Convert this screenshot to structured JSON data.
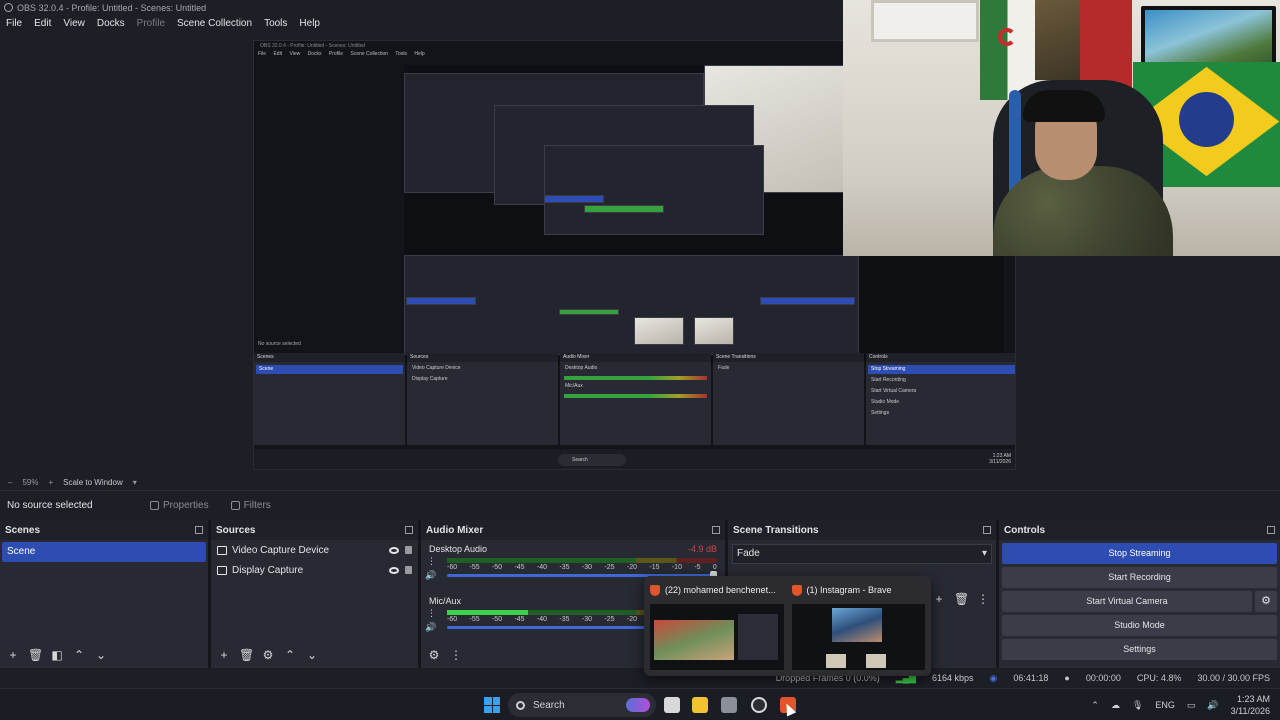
{
  "window": {
    "title": "OBS 32.0.4 - Profile: Untitled - Scenes: Untitled"
  },
  "menu": [
    "File",
    "Edit",
    "View",
    "Docks",
    "Profile",
    "Scene Collection",
    "Tools",
    "Help"
  ],
  "nested_preview": {
    "title": "OBS 32.0.4 - Profile: Untitled - Scenes: Untitled",
    "menu": [
      "File",
      "Edit",
      "View",
      "Docks",
      "Profile",
      "Scene Collection",
      "Tools",
      "Help"
    ],
    "info": "No source selected",
    "scale": "59%",
    "scale_mode": "Scale to Window",
    "docks": [
      "Scenes",
      "Sources",
      "Audio Mixer",
      "Scene Transitions",
      "Controls"
    ],
    "scene": "Scene",
    "sources": [
      "Video Capture Device",
      "Display Capture"
    ],
    "mixer": [
      "Desktop Audio",
      "Mic/Aux"
    ],
    "transition": "Fade",
    "controls": [
      "Stop Streaming",
      "Start Recording",
      "Start Virtual Camera",
      "Studio Mode",
      "Settings"
    ],
    "search": "Search",
    "clock": "1:23 AM",
    "date": "3/11/2026",
    "lang": "ENG",
    "status": "6164 kbps   06:41:18   00:00:00   CPU: 4.8%   30.00 / 30.00 FPS"
  },
  "scalebar": {
    "zoom": "59%",
    "mode": "Scale to Window",
    "minus": "–",
    "plus": "+"
  },
  "source_toolbar": {
    "no_source": "No source selected",
    "properties": "Properties",
    "filters": "Filters"
  },
  "scenes": {
    "title": "Scenes",
    "items": [
      "Scene"
    ]
  },
  "sources": {
    "title": "Sources",
    "items": [
      "Video Capture Device",
      "Display Capture"
    ]
  },
  "mixer": {
    "title": "Audio Mixer",
    "channels": [
      {
        "name": "Desktop Audio",
        "db": "-4.9 dB",
        "level": 0.0
      },
      {
        "name": "Mic/Aux",
        "db": "",
        "level": 0.3
      }
    ],
    "ticks": [
      "-60",
      "-55",
      "-50",
      "-45",
      "-40",
      "-35",
      "-30",
      "-25",
      "-20",
      "-15",
      "-10",
      "-5",
      "0"
    ]
  },
  "transitions": {
    "title": "Scene Transitions",
    "selected": "Fade"
  },
  "controls": {
    "title": "Controls",
    "stop_streaming": "Stop Streaming",
    "start_recording": "Start Recording",
    "start_virtual_camera": "Start Virtual Camera",
    "studio_mode": "Studio Mode",
    "settings": "Settings"
  },
  "status": {
    "dropped": "Dropped Frames 0 (0.0%)",
    "bitrate": "6164 kbps",
    "stream_time": "06:41:18",
    "rec_time": "00:00:00",
    "cpu": "CPU: 4.8%",
    "fps": "30.00 / 30.00 FPS"
  },
  "thumbnails": [
    {
      "title": "(22) mohamed benchenet..."
    },
    {
      "title": "(1) Instagram - Brave"
    }
  ],
  "taskbar": {
    "search": "Search",
    "lang": "ENG",
    "time": "1:23 AM",
    "date": "3/11/2026"
  },
  "colors": {
    "accent": "#2d4db3",
    "dock_bg": "#272a33",
    "window_bg": "#1d1f26"
  }
}
